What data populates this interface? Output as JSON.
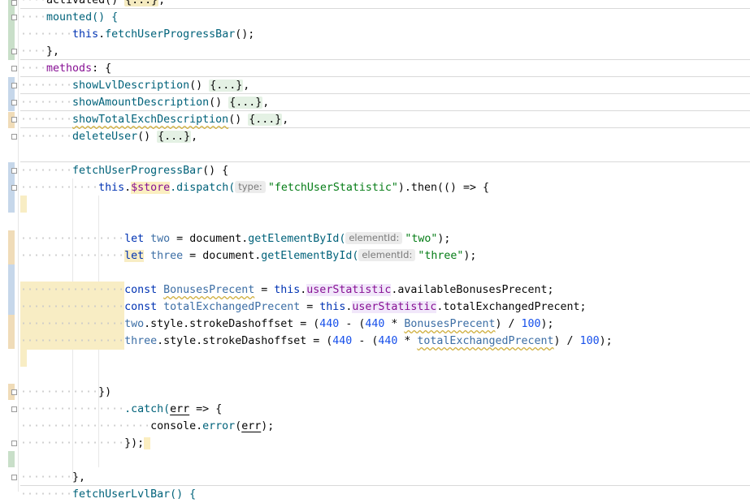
{
  "editor": {
    "lines": {
      "l0_a": "activated() ",
      "l0_fold": "{...}",
      "l0_b": ",",
      "l1_a": "mounted() {",
      "l2_this": "this",
      "l2_b": ".",
      "l2_fn": "fetchUserProgressBar",
      "l2_c": "();",
      "l3": "},",
      "l4_key": "methods",
      "l4_b": ": {",
      "l5_fn": "showLvlDescription",
      "l5_b": "() ",
      "l5_fold": "{...}",
      "l5_c": ",",
      "l6_fn": "showAmountDescription",
      "l6_b": "() ",
      "l6_fold": "{...}",
      "l6_c": ",",
      "l7_fn": "showTotalExchDescription",
      "l7_b": "() ",
      "l7_fold": "{...}",
      "l7_c": ",",
      "l8_fn": "deleteUser",
      "l8_b": "() ",
      "l8_fold": "{...}",
      "l8_c": ",",
      "l10_fn": "fetchUserProgressBar",
      "l10_b": "() {",
      "l11_this": "this",
      "l11_dot": ".",
      "l11_store": "$store",
      "l11_dispatch": ".dispatch(",
      "l11_hint": "type:",
      "l11_str": "\"fetchUserStatistic\"",
      "l11_then": ").then(() => {",
      "l14_kw": "let",
      "l14_var": "two",
      "l14_eq": " = document.",
      "l14_fn": "getElementById(",
      "l14_hint": "elementId:",
      "l14_str": "\"two\"",
      "l14_end": ");",
      "l15_kw": "let",
      "l15_var": "three",
      "l15_eq": " = document.",
      "l15_fn": "getElementById(",
      "l15_hint": "elementId:",
      "l15_str": "\"three\"",
      "l15_end": ");",
      "l17_kw": "const",
      "l17_var": "BonusesPrecent",
      "l17_eq": " = ",
      "l17_this": "this",
      "l17_prop": "userStatistic",
      "l17_end": ".availableBonusesPrecent;",
      "l18_kw": "const",
      "l18_var": "totalExchangedPrecent",
      "l18_eq": " = ",
      "l18_this": "this",
      "l18_prop": "userStatistic",
      "l18_end": ".totalExchangedPrecent;",
      "l19_var": "two",
      "l19_mid": ".style.strokeDashoffset = (",
      "l19_n1": "440",
      "l19_op": " - (",
      "l19_n2": "440",
      "l19_star": " * ",
      "l19_v2": "BonusesPrecent",
      "l19_close": ") / ",
      "l19_n3": "100",
      "l19_end": ");",
      "l20_var": "three",
      "l20_mid": ".style.strokeDashoffset = (",
      "l20_n1": "440",
      "l20_op": " - (",
      "l20_n2": "440",
      "l20_star": " * ",
      "l20_v2": "totalExchangedPrecent",
      "l20_close": ") / ",
      "l20_n3": "100",
      "l20_end": ");",
      "l23": "})",
      "l24_a": ".catch(",
      "l24_err": "err",
      "l24_b": " => {",
      "l25_a": "console.",
      "l25_fn": "error",
      "l25_b": "(",
      "l25_err": "err",
      "l25_c": ");",
      "l26": "});",
      "l28": "},",
      "l29": "fetchUserLvlBar() {"
    }
  },
  "colors": {
    "keyword": "#000080",
    "string": "#067d17",
    "number": "#1750eb",
    "property": "#871094",
    "folded_block": "#e4f1e4",
    "highlight": "#f8edc4"
  }
}
